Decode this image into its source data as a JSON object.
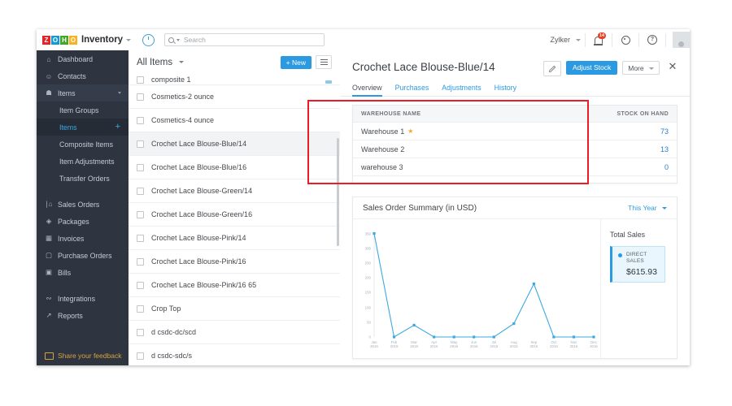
{
  "topbar": {
    "logo_letters": [
      "Z",
      "O",
      "H",
      "O"
    ],
    "app_name": "Inventory",
    "search_placeholder": "Search",
    "org_name": "Zylker",
    "notification_count": "14"
  },
  "sidebar": {
    "items": [
      {
        "label": "Dashboard",
        "icon": "home-icon"
      },
      {
        "label": "Contacts",
        "icon": "person-icon"
      },
      {
        "label": "Items",
        "icon": "basket-icon"
      }
    ],
    "sub_items": [
      {
        "label": "Item Groups"
      },
      {
        "label": "Items"
      },
      {
        "label": "Composite Items"
      },
      {
        "label": "Item Adjustments"
      },
      {
        "label": "Transfer Orders"
      }
    ],
    "items_group2": [
      {
        "label": "Sales Orders",
        "icon": "cart-icon"
      },
      {
        "label": "Packages",
        "icon": "package-icon"
      },
      {
        "label": "Invoices",
        "icon": "invoice-icon"
      },
      {
        "label": "Purchase Orders",
        "icon": "bag-icon"
      },
      {
        "label": "Bills",
        "icon": "bill-icon"
      }
    ],
    "items_group3": [
      {
        "label": "Integrations",
        "icon": "plug-icon"
      },
      {
        "label": "Reports",
        "icon": "chart-icon"
      }
    ],
    "feedback": "Share your feedback"
  },
  "list": {
    "title": "All Items",
    "new_button": "+ New",
    "rows": [
      "composite 1",
      "Cosmetics-2 ounce",
      "Cosmetics-4 ounce",
      "Crochet Lace Blouse-Blue/14",
      "Crochet Lace Blouse-Blue/16",
      "Crochet Lace Blouse-Green/14",
      "Crochet Lace Blouse-Green/16",
      "Crochet Lace Blouse-Pink/14",
      "Crochet Lace Blouse-Pink/16",
      "Crochet Lace Blouse-Pink/16 65",
      "Crop Top",
      "d csdc-dc/scd",
      "d csdc-sdc/s"
    ],
    "selected_index": 3
  },
  "detail": {
    "title": "Crochet Lace Blouse-Blue/14",
    "adjust_stock": "Adjust Stock",
    "more": "More",
    "tabs": [
      {
        "label": "Overview",
        "active": true
      },
      {
        "label": "Purchases",
        "active": false
      },
      {
        "label": "Adjustments",
        "active": false
      },
      {
        "label": "History",
        "active": false
      }
    ],
    "warehouse_table": {
      "headers": [
        "WAREHOUSE NAME",
        "STOCK ON HAND"
      ],
      "rows": [
        {
          "name": "Warehouse 1",
          "primary": true,
          "stock": "73"
        },
        {
          "name": "Warehouse 2",
          "primary": false,
          "stock": "13"
        },
        {
          "name": "warehouse 3",
          "primary": false,
          "stock": "0"
        }
      ]
    },
    "total_sales_label": "Total Sales",
    "legend_name": "DIRECT SALES",
    "legend_amount": "$615.93"
  },
  "chart_data": {
    "type": "line",
    "title": "Sales Order Summary (in USD)",
    "range_selector": "This Year",
    "xlabel": "",
    "ylabel": "",
    "year": "2016",
    "categories": [
      "Jan",
      "Feb",
      "Mar",
      "Apr",
      "May",
      "Jun",
      "Jul",
      "Aug",
      "Sep",
      "Oct",
      "Nov",
      "Dec"
    ],
    "series": [
      {
        "name": "DIRECT SALES",
        "color": "#3ca9e0",
        "values": [
          350,
          0,
          40,
          0,
          0,
          0,
          0,
          45,
          180,
          0,
          0,
          0
        ]
      }
    ],
    "yticks": [
      0,
      50,
      100,
      150,
      200,
      250,
      300,
      350
    ],
    "ylim": [
      0,
      360
    ],
    "grid": false,
    "legend_position": "right"
  },
  "annotations": {
    "highlight_color": "#ec1c24"
  }
}
